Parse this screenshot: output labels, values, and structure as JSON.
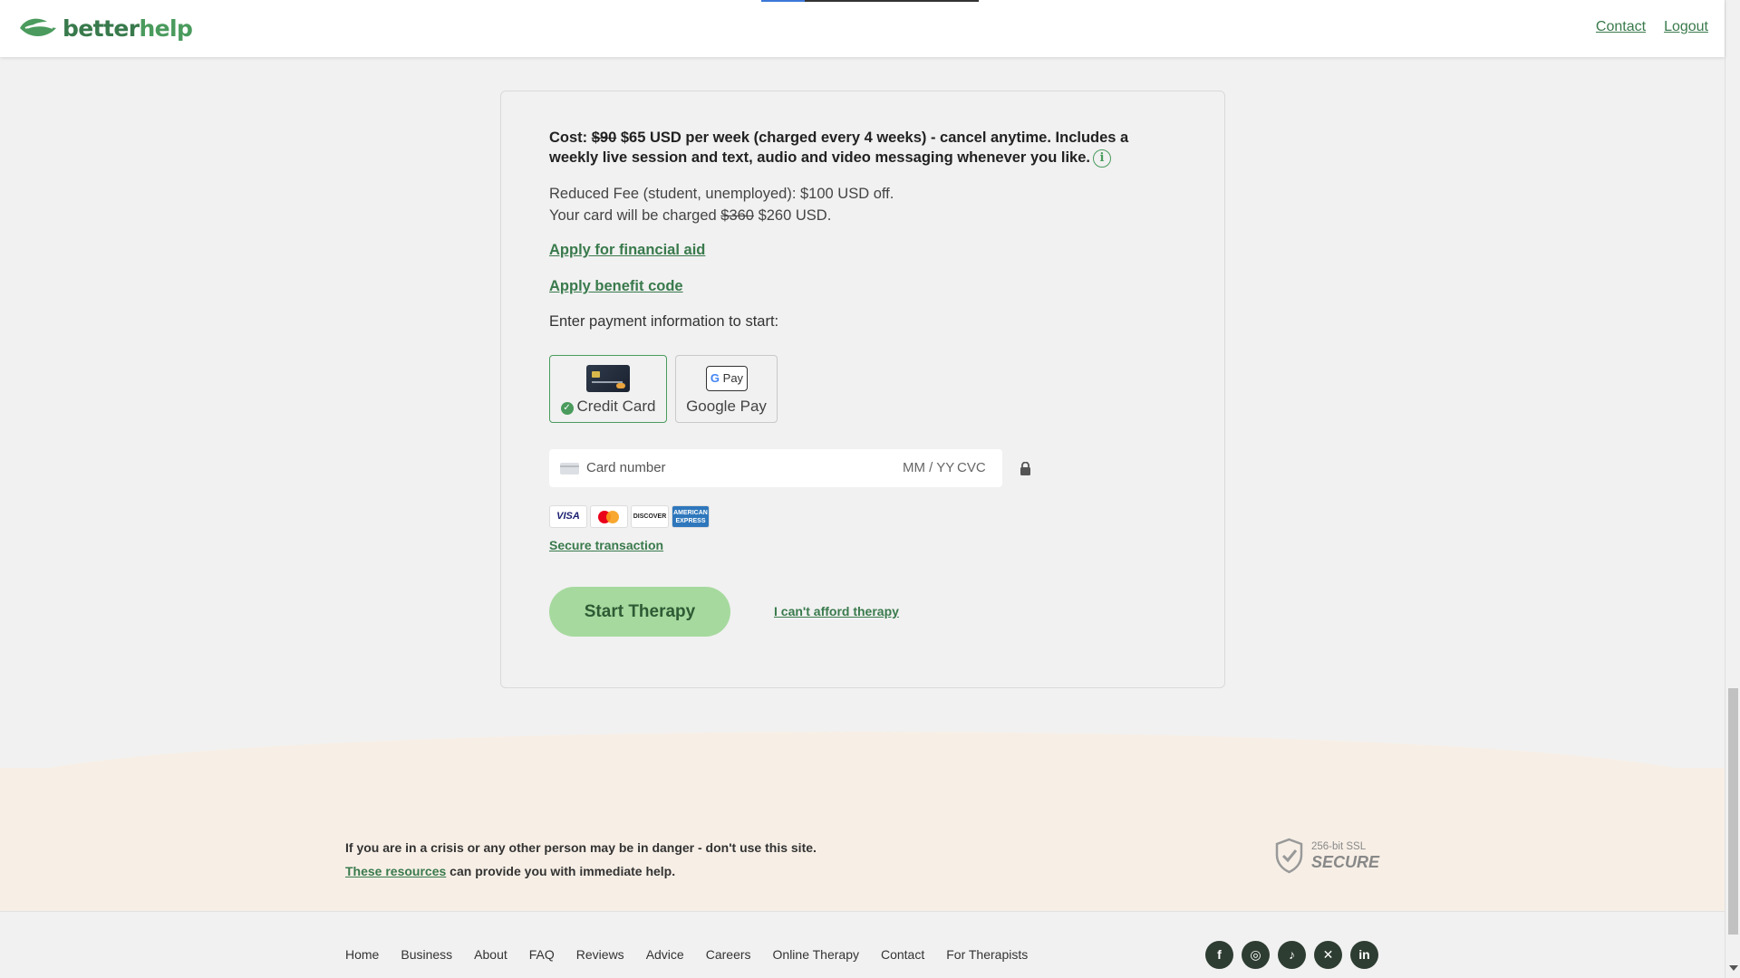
{
  "header": {
    "logo_better": "better",
    "logo_help": "help",
    "nav": [
      {
        "label": "Contact"
      },
      {
        "label": "Logout"
      }
    ]
  },
  "payment": {
    "cost_prefix": "Cost: ",
    "cost_old": "$90",
    "cost_text": " $65 USD per week (charged every 4 weeks) - cancel anytime. Includes a weekly live session and text, audio and video messaging whenever you like.",
    "info_symbol": "i",
    "reduced_line": "Reduced Fee (student, unemployed): $100 USD off.",
    "charged_prefix": "Your card will be charged ",
    "charged_old": "$360",
    "charged_new": " $260 USD.",
    "financial_aid_link": "Apply for financial aid",
    "benefit_code_link": "Apply benefit code",
    "enter_prompt": "Enter payment information to start:",
    "options": {
      "credit_label": "Credit Card",
      "credit_check": "✓",
      "gpay_label": "Google Pay",
      "gpay_badge_g": "G",
      "gpay_badge_pay": " Pay"
    },
    "card_input": {
      "number_placeholder": "Card number",
      "exp_placeholder": "MM / YY",
      "cvc_placeholder": "CVC"
    },
    "brands": {
      "visa": "VISA",
      "discover": "DISCOVER",
      "amex": "AMERICAN EXPRESS"
    },
    "secure_link": "Secure transaction",
    "start_button": "Start Therapy",
    "cant_afford_link": "I can't afford therapy"
  },
  "footer": {
    "crisis_line1": "If you are in a crisis or any other person may be in danger - don't use this site.",
    "resources_link": "These resources",
    "crisis_line2_rest": " can provide you with immediate help.",
    "ssl_small": "256-bit SSL",
    "ssl_big": "SECURE",
    "links": [
      "Home",
      "Business",
      "About",
      "FAQ",
      "Reviews",
      "Advice",
      "Careers",
      "Online Therapy",
      "Contact",
      "For Therapists"
    ],
    "socials": [
      {
        "icon": "facebook-icon",
        "glyph": "f"
      },
      {
        "icon": "instagram-icon",
        "glyph": "◎"
      },
      {
        "icon": "tiktok-icon",
        "glyph": "♪"
      },
      {
        "icon": "x-icon",
        "glyph": "✕"
      },
      {
        "icon": "linkedin-icon",
        "glyph": "in"
      }
    ]
  },
  "colors": {
    "brand_green": "#397a4c",
    "button_green": "#a6d99e",
    "footer_beige": "#f7efe6",
    "social_dark": "#2e3d32"
  }
}
